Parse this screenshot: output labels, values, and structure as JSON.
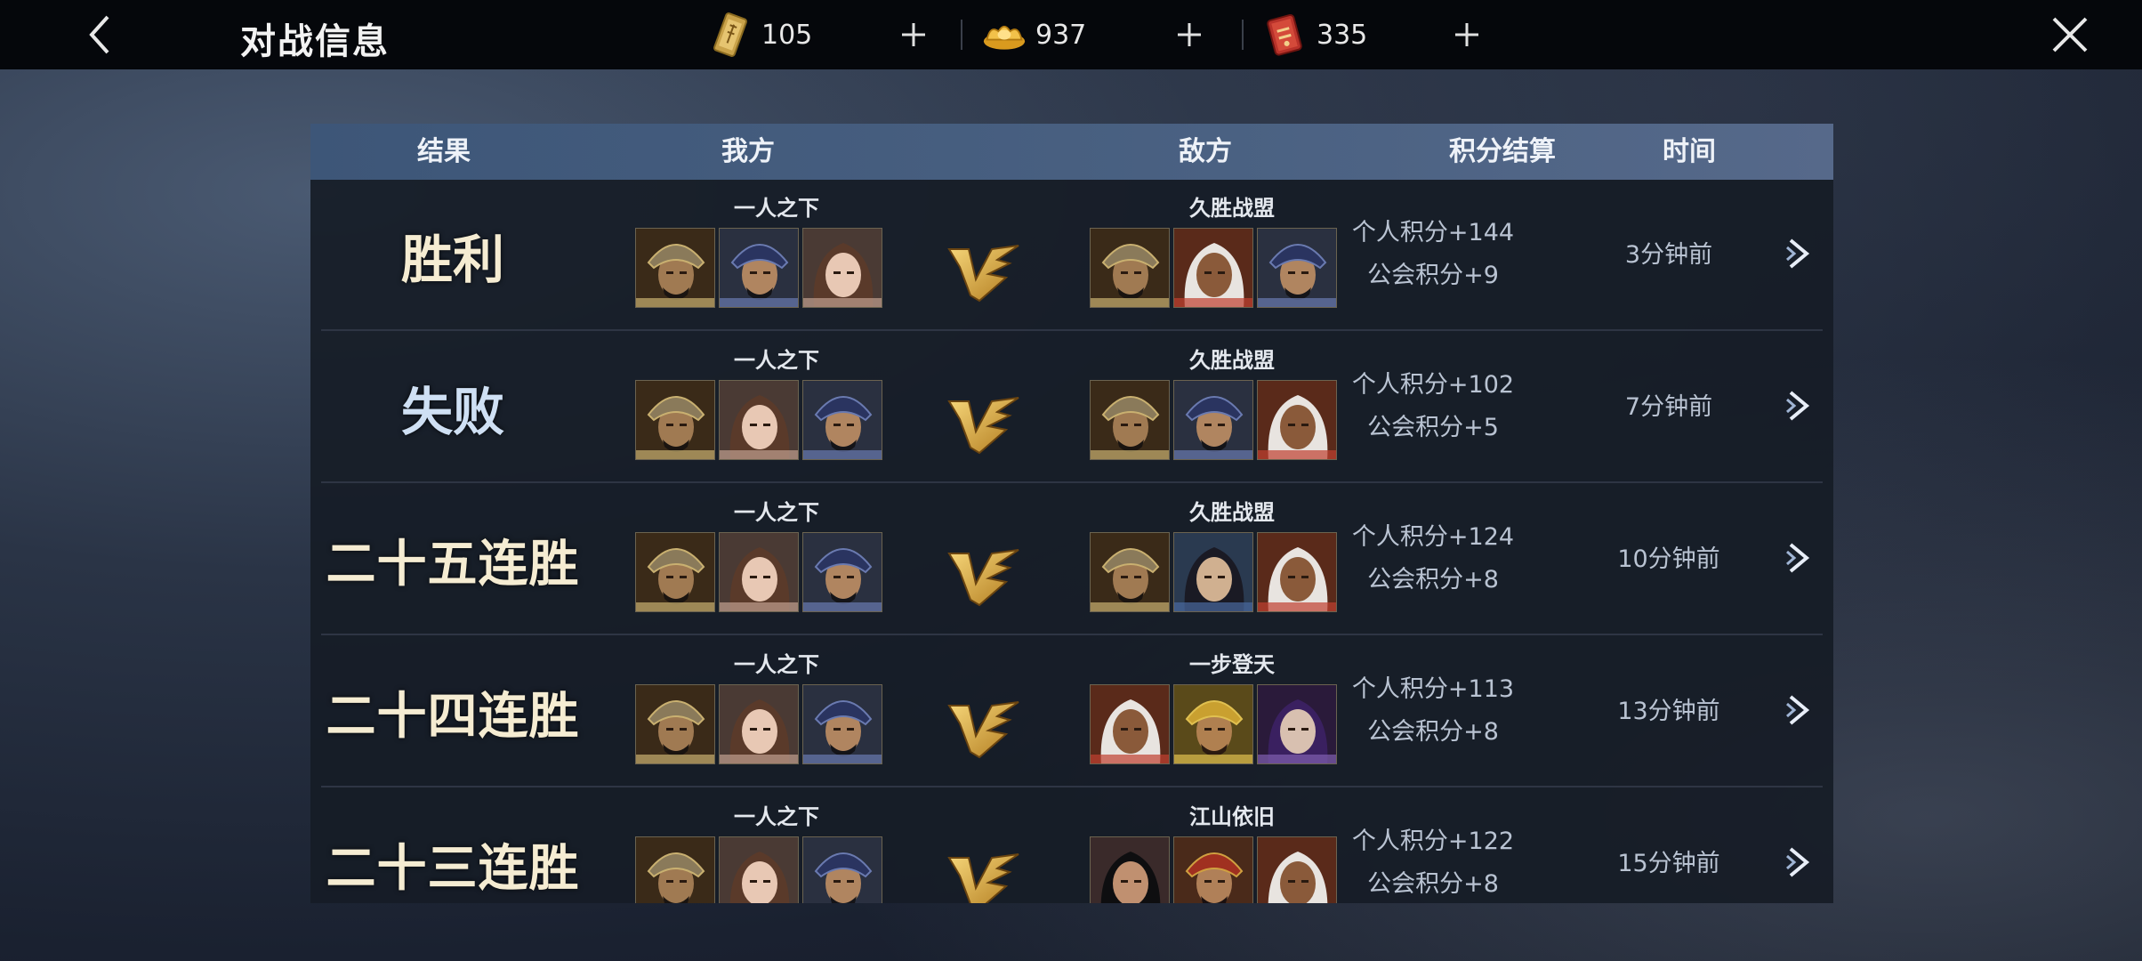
{
  "header": {
    "title": "对战信息",
    "currencies": [
      {
        "icon": "token-card-icon",
        "amount": "105"
      },
      {
        "icon": "gold-ingot-icon",
        "amount": "937"
      },
      {
        "icon": "red-scroll-icon",
        "amount": "335"
      }
    ]
  },
  "table": {
    "headers": {
      "result": "结果",
      "ours": "我方",
      "enemy": "敌方",
      "score": "积分结算",
      "time": "时间"
    },
    "rows": [
      {
        "result": "胜利",
        "result_type": "win",
        "our_guild": "一人之下",
        "enemy_guild": "久胜战盟",
        "our_heroes": [
          "masked-warrior",
          "bearded-general",
          "lady-brown-hair"
        ],
        "enemy_heroes": [
          "masked-warrior",
          "white-hair-woman",
          "bearded-general"
        ],
        "personal": "个人积分+144",
        "guild_score": "公会积分+9",
        "time": "3分钟前"
      },
      {
        "result": "失败",
        "result_type": "lose",
        "our_guild": "一人之下",
        "enemy_guild": "久胜战盟",
        "our_heroes": [
          "masked-warrior",
          "lady-brown-hair",
          "bearded-general"
        ],
        "enemy_heroes": [
          "masked-warrior",
          "bearded-general",
          "white-hair-woman"
        ],
        "personal": "个人积分+102",
        "guild_score": "公会积分+5",
        "time": "7分钟前"
      },
      {
        "result": "二十五连胜",
        "result_type": "streak",
        "our_guild": "一人之下",
        "enemy_guild": "久胜战盟",
        "our_heroes": [
          "masked-warrior",
          "lady-brown-hair",
          "bearded-general"
        ],
        "enemy_heroes": [
          "masked-warrior",
          "blue-young-warrior",
          "white-hair-woman"
        ],
        "personal": "个人积分+124",
        "guild_score": "公会积分+8",
        "time": "10分钟前"
      },
      {
        "result": "二十四连胜",
        "result_type": "streak",
        "our_guild": "一人之下",
        "enemy_guild": "一步登天",
        "our_heroes": [
          "masked-warrior",
          "lady-brown-hair",
          "bearded-general"
        ],
        "enemy_heroes": [
          "white-hair-woman",
          "golden-armor-warrior",
          "purple-hair-man"
        ],
        "personal": "个人积分+113",
        "guild_score": "公会积分+8",
        "time": "13分钟前"
      },
      {
        "result": "二十三连胜",
        "result_type": "streak",
        "our_guild": "一人之下",
        "enemy_guild": "江山依旧",
        "our_heroes": [
          "masked-warrior",
          "lady-brown-hair",
          "bearded-general"
        ],
        "enemy_heroes": [
          "black-hair-warrior",
          "red-helmet-warrior",
          "white-hair-woman"
        ],
        "personal": "个人积分+122",
        "guild_score": "公会积分+8",
        "time": "15分钟前"
      }
    ]
  },
  "colors": {
    "header_bg": "#4a6182",
    "gold": "#d9a23a",
    "text": "#b9c3d2"
  }
}
